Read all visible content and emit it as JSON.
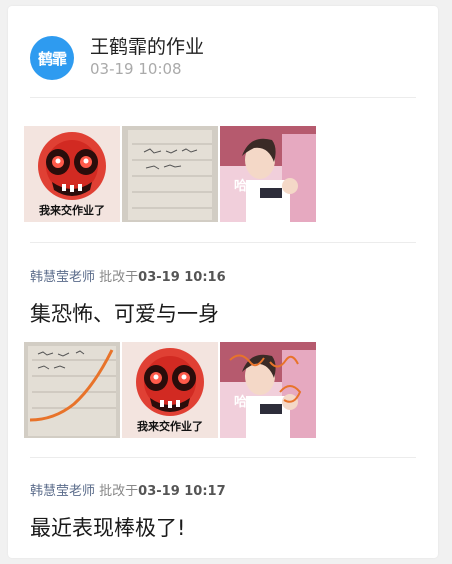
{
  "post": {
    "avatar_text": "鹤霏",
    "author": "王鹤霏的作业",
    "time": "03-19 10:08",
    "attachments": [
      {
        "icon": "skull-meme-image",
        "caption": "我来交作业了"
      },
      {
        "icon": "notebook-page-image",
        "caption": ""
      },
      {
        "icon": "idol-photo-image",
        "caption": "哈"
      }
    ]
  },
  "comments": [
    {
      "teacher": "韩慧莹老师",
      "action": " 批改于",
      "time": "03-19 10:16",
      "text": "集恐怖、可爱与一身",
      "attachments": [
        {
          "icon": "graded-notebook-image",
          "caption": ""
        },
        {
          "icon": "skull-meme-image",
          "caption": "我来交作业了"
        },
        {
          "icon": "idol-photo-annotated-image",
          "caption": "哈"
        }
      ]
    },
    {
      "teacher": "韩慧莹老师",
      "action": " 批改于",
      "time": "03-19 10:17",
      "text": "最近表现棒极了!"
    }
  ],
  "colors": {
    "avatar": "#2e9bf0",
    "teacher_name": "#5a6b8a",
    "correction_ink": "#e8732a"
  }
}
